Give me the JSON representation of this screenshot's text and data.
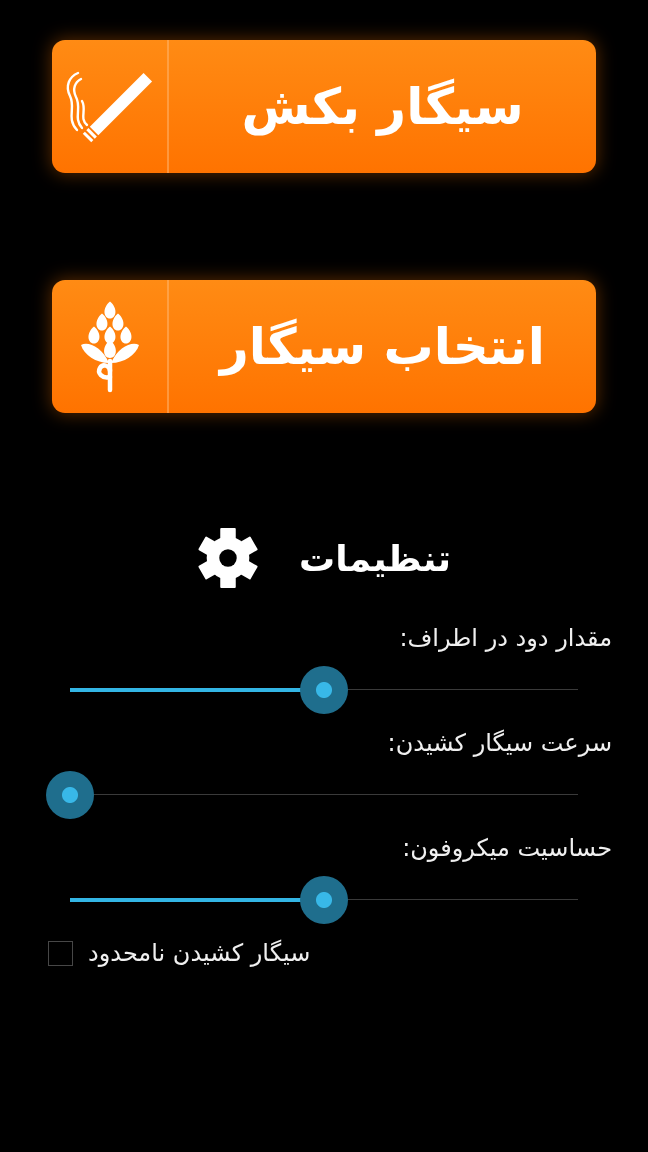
{
  "buttons": [
    {
      "label": "سیگار بکش",
      "kind": "smoke"
    },
    {
      "label": "انتخاب سیگار",
      "kind": "select"
    }
  ],
  "settings": {
    "title": "تنظیمات",
    "sliders": [
      {
        "label": "مقدار دود در اطراف:",
        "level": 0.5
      },
      {
        "label": "سرعت سیگار کشیدن:",
        "level": 0
      },
      {
        "label": "حساسیت میکروفون:",
        "level": 0.5
      }
    ],
    "checkbox": {
      "label": "سیگار کشیدن نامحدود",
      "checked": false
    }
  }
}
